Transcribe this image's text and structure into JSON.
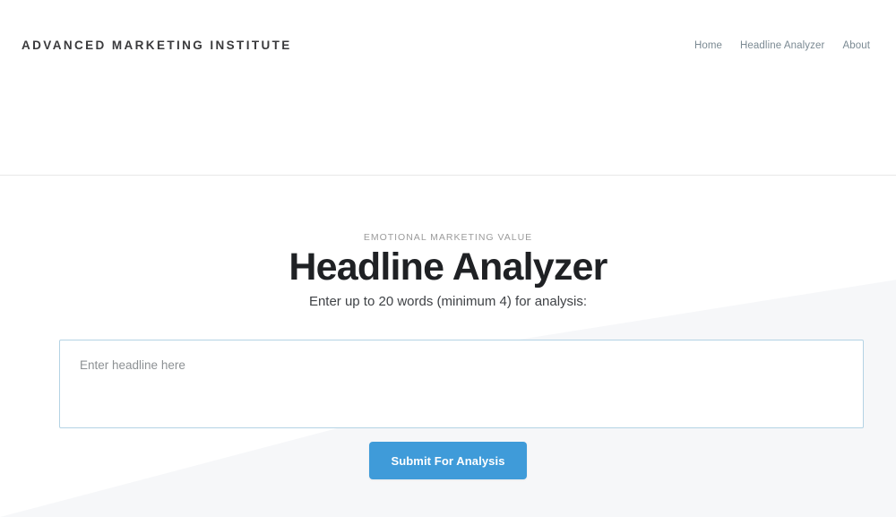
{
  "header": {
    "brand": "ADVANCED MARKETING INSTITUTE",
    "nav": [
      {
        "label": "Home"
      },
      {
        "label": "Headline Analyzer"
      },
      {
        "label": "About"
      }
    ]
  },
  "hero": {
    "eyebrow": "EMOTIONAL MARKETING VALUE",
    "title": "Headline Analyzer",
    "subtitle": "Enter up to 20 words (minimum 4) for analysis:"
  },
  "form": {
    "headline_placeholder": "Enter headline here",
    "headline_value": "",
    "submit_label": "Submit For Analysis"
  },
  "theme": {
    "accent": "#3f9bd9",
    "input_border": "#b4d3e4",
    "page_bg": "#ffffff",
    "wedge_bg": "#f6f7f9",
    "text_dark": "#1f2124",
    "text_muted": "#9b9b9b",
    "nav_text": "#7b8a93"
  }
}
